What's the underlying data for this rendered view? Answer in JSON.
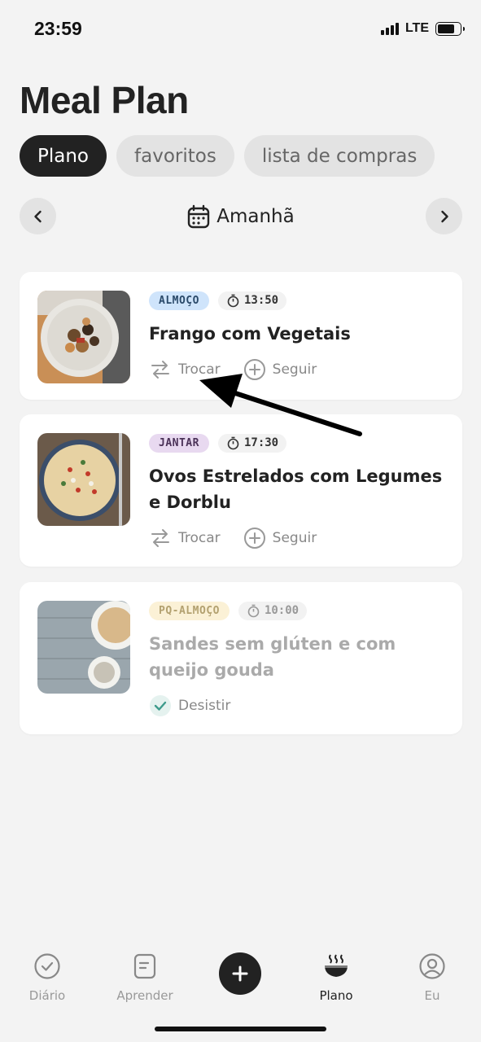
{
  "status": {
    "time": "23:59",
    "network": "LTE"
  },
  "page": {
    "title": "Meal Plan"
  },
  "tabs": [
    {
      "label": "Plano",
      "active": true
    },
    {
      "label": "favoritos",
      "active": false
    },
    {
      "label": "lista de compras",
      "active": false
    }
  ],
  "date_nav": {
    "label": "Amanhã",
    "prev_icon": "chevron-left-icon",
    "next_icon": "chevron-right-icon",
    "calendar_icon": "calendar-icon"
  },
  "meals": [
    {
      "type": "ALMOÇO",
      "type_bg": "#cfe4fb",
      "type_color": "#2b4a6a",
      "time": "13:50",
      "title": "Frango com Vegetais",
      "actions": [
        {
          "label": "Trocar",
          "icon": "swap-icon"
        },
        {
          "label": "Seguir",
          "icon": "plus-circle-icon"
        }
      ]
    },
    {
      "type": "JANTAR",
      "type_bg": "#e8d9f0",
      "type_color": "#4b3258",
      "time": "17:30",
      "title": "Ovos Estrelados com Legumes e Dorblu",
      "actions": [
        {
          "label": "Trocar",
          "icon": "swap-icon"
        },
        {
          "label": "Seguir",
          "icon": "plus-circle-icon"
        }
      ]
    },
    {
      "type": "PQ-ALMOÇO",
      "type_bg": "#fbf1d6",
      "type_color": "#b3a170",
      "time": "10:00",
      "title": "Sandes sem glúten e com queijo gouda",
      "actions": [
        {
          "label": "Desistir",
          "icon": "check-icon"
        }
      ]
    }
  ],
  "tabbar": {
    "items": [
      {
        "label": "Diário",
        "icon": "check-circle-icon"
      },
      {
        "label": "Aprender",
        "icon": "book-icon"
      },
      {
        "label": "Plano",
        "icon": "bowl-icon",
        "active": true
      },
      {
        "label": "Eu",
        "icon": "user-circle-icon"
      }
    ],
    "add_icon": "plus-icon"
  },
  "colors": {
    "accent": "#222222",
    "background": "#f3f3f3",
    "check": "#3e9b8c"
  }
}
